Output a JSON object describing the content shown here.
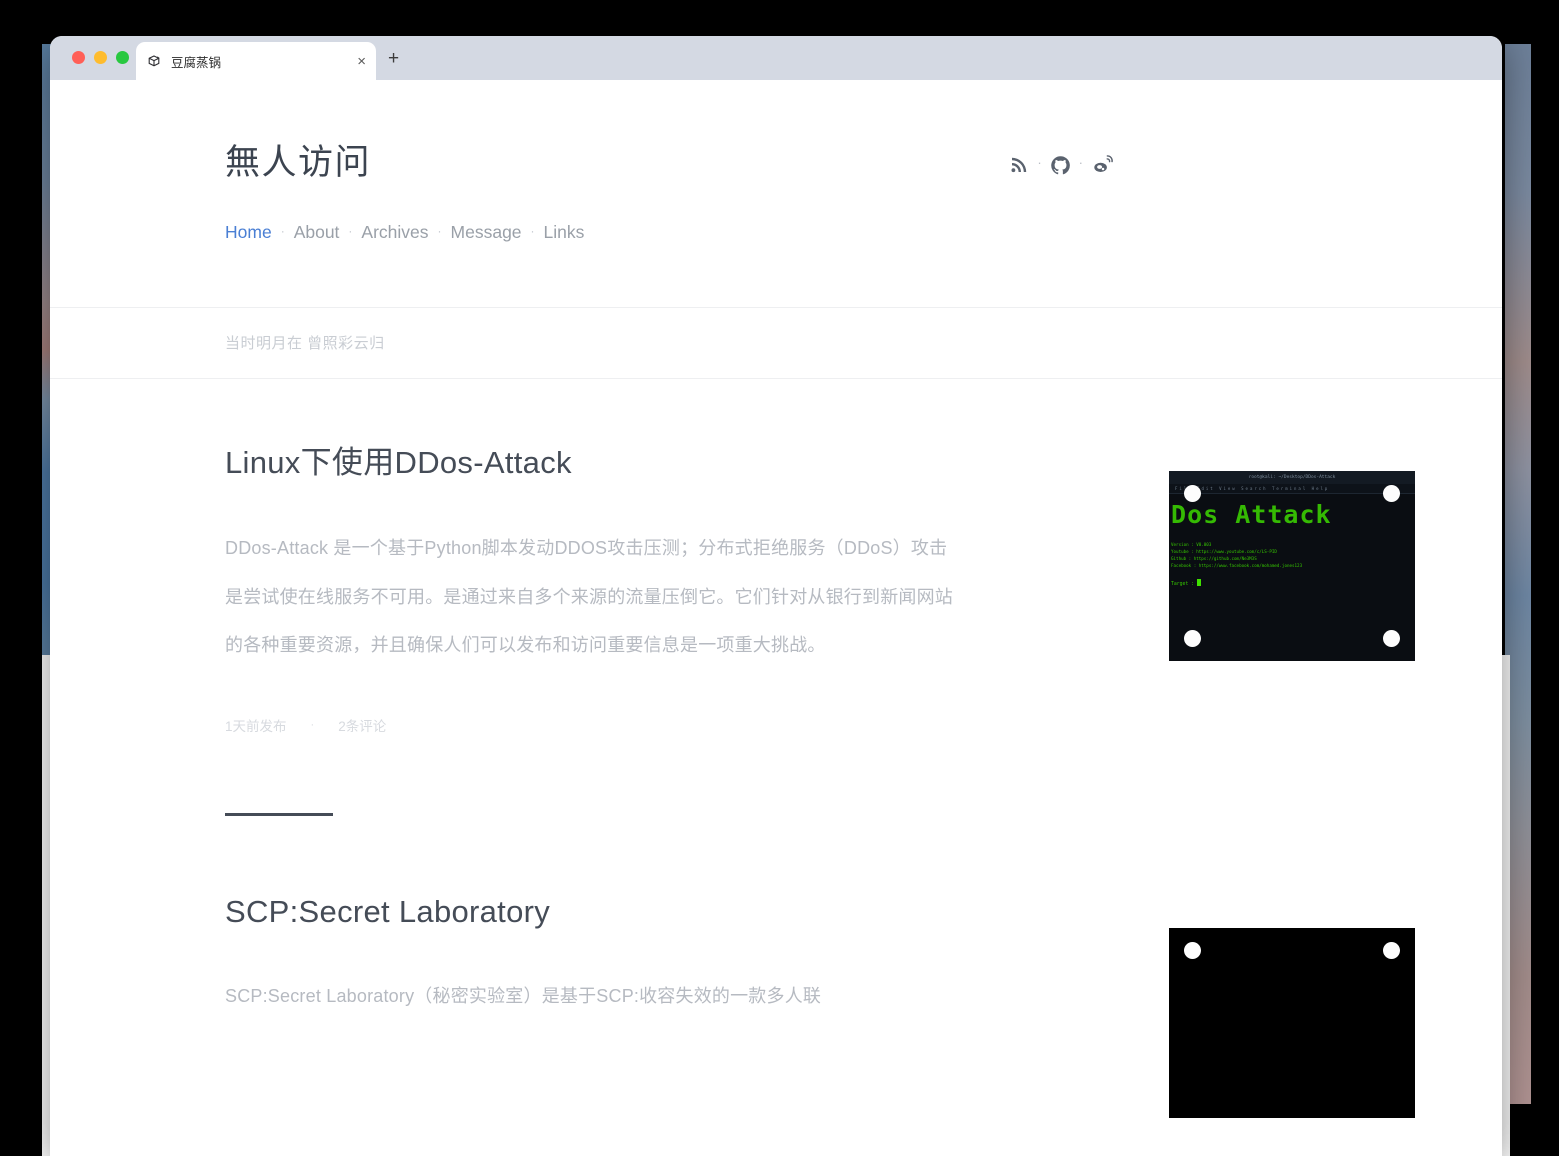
{
  "browser": {
    "tab": {
      "title": "豆腐蒸锅",
      "favicon_icon": "cube-favicon",
      "close_label": "×"
    },
    "new_tab_label": "+",
    "traffic_lights": [
      {
        "name": "close",
        "color": "#ff5f57"
      },
      {
        "name": "minimize",
        "color": "#febc2e"
      },
      {
        "name": "maximize",
        "color": "#28c840"
      }
    ]
  },
  "site": {
    "title": "無人访问",
    "tagline": "当时明月在 曾照彩云归",
    "nav": [
      {
        "label": "Home",
        "active": true
      },
      {
        "label": "About",
        "active": false
      },
      {
        "label": "Archives",
        "active": false
      },
      {
        "label": "Message",
        "active": false
      },
      {
        "label": "Links",
        "active": false
      }
    ],
    "nav_separator": "·",
    "social": [
      {
        "icon": "rss-icon",
        "label": "RSS"
      },
      {
        "icon": "github-icon",
        "label": "GitHub"
      },
      {
        "icon": "weibo-icon",
        "label": "Weibo"
      }
    ],
    "social_separator": "·",
    "accent_color": "#4a7fd4",
    "title_color": "#3c4450",
    "muted_color": "#b6bac1"
  },
  "posts": [
    {
      "title": "Linux下使用DDos-Attack",
      "body": "DDos-Attack 是一个基于Python脚本发动DDOS攻击压测；分布式拒绝服务（DDoS）攻击是尝试使在线服务不可用。是通过来自多个来源的流量压倒它。它们针对从银行到新闻网站的各种重要资源，并且确保人们可以发布和访问重要信息是一项重大挑战。",
      "published": "1天前发布",
      "meta_separator": "·",
      "comments": "2条评论",
      "thumbnail": {
        "type": "terminal-screenshot",
        "titlebar": "root@kali: ~/Desktop/DDos-Attack",
        "menubar": "File  Edit  View  Search  Terminal  Help",
        "ascii_title": "DDos Attack",
        "lines": [
          "Version   : V0.003",
          "Youtube   : https://www.youtube.com/c/LS-PID",
          "Github    : https://github.com/Ne3M3S",
          "Facebook  : https://www.facebook.com/mohamed.jones123"
        ],
        "prompt": "Target : ",
        "background": "#0a0d12",
        "text_color": "#3fe000"
      }
    },
    {
      "title": "SCP:Secret Laboratory",
      "body": "SCP:Secret Laboratory（秘密实验室）是基于SCP:收容失效的一款多人联",
      "thumbnail": {
        "type": "black-screenshot",
        "background": "#000000"
      }
    }
  ]
}
